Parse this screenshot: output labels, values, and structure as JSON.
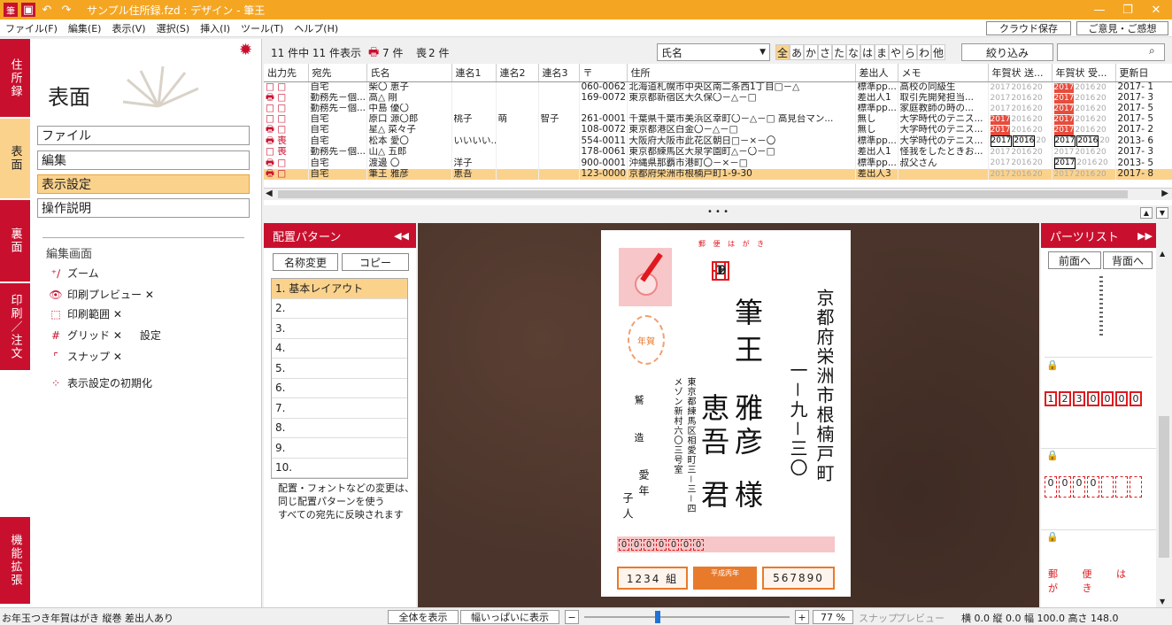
{
  "titlebar": {
    "title": "サンプル住所録.fzd : デザイン - 筆王",
    "minimize": "—",
    "restore": "❐",
    "close": "✕"
  },
  "menu": [
    "ファイル(F)",
    "編集(E)",
    "表示(V)",
    "選択(S)",
    "挿入(I)",
    "ツール(T)",
    "ヘルプ(H)"
  ],
  "top_buttons": {
    "cloud": "クラウド保存",
    "feedback": "ご意見・ご感想"
  },
  "vtabs": [
    "住所録",
    "表面",
    "裏面",
    "印刷／注文",
    "機能拡張"
  ],
  "left": {
    "title": "表面",
    "nav": [
      "ファイル",
      "編集",
      "表示設定",
      "操作説明"
    ],
    "section": "編集画面",
    "tools": [
      {
        "label": "ズーム"
      },
      {
        "label": "印刷プレビュー ✕"
      },
      {
        "label": "印刷範囲 ✕"
      },
      {
        "label": "グリッド ✕",
        "extra": "設定"
      },
      {
        "label": "スナップ ✕"
      },
      {
        "label": "表示設定の初期化"
      }
    ]
  },
  "list": {
    "count_text": "11 件中 11 件表示",
    "printer_count": "7 件",
    "mourn_label": "喪",
    "mourn_count": "2 件",
    "sort": "氏名",
    "kana": [
      "全",
      "あ",
      "か",
      "さ",
      "た",
      "な",
      "は",
      "ま",
      "や",
      "ら",
      "わ",
      "他"
    ],
    "filter_btn": "絞り込み",
    "search_placeholder": "",
    "headers": [
      "出力先",
      "宛先",
      "氏名",
      "連名1",
      "連名2",
      "連名3",
      "〒",
      "住所",
      "差出人",
      "メモ",
      "年賀状 送...",
      "年賀状 受...",
      "更新日"
    ],
    "rows": [
      [
        "□ □",
        "自宅",
        "柴〇 恵子",
        "",
        "",
        "",
        "060-0062",
        "北海道札幌市中央区南二条西1丁目□－△",
        "標準pp...",
        "高校の同級生"
      ],
      [
        "🖶 □",
        "勤務先－個...",
        "高△ 剛",
        "",
        "",
        "",
        "169-0072",
        "東京都新宿区大久保〇－△－□",
        "差出人1",
        "取引先開発担当..."
      ],
      [
        "□ □",
        "勤務先－個...",
        "中島 優〇",
        "",
        "",
        "",
        "",
        "",
        "標準pp...",
        "家庭教師の時の..."
      ],
      [
        "□ □",
        "自宅",
        "原口 源〇郎",
        "桃子",
        "萌",
        "智子",
        "261-0001",
        "千葉県千葉市美浜区幸町〇－△－□ 高見台マン...",
        "無し",
        "大学時代のテニス..."
      ],
      [
        "🖶 □",
        "自宅",
        "星△ 菜々子",
        "",
        "",
        "",
        "108-0072",
        "東京都港区白金〇－△－□",
        "無し",
        "大学時代のテニス..."
      ],
      [
        "🖶 喪",
        "自宅",
        "松本 愛〇",
        "いいいい...",
        "",
        "",
        "554-0011",
        "大阪府大阪市此花区朝日□－×－〇",
        "標準pp...",
        "大学時代のテニス..."
      ],
      [
        "□ 喪",
        "勤務先－個...",
        "山△ 五郎",
        "",
        "",
        "",
        "178-0061",
        "東京都練馬区大泉学園町△－〇－□",
        "差出人1",
        "怪我をしたときお..."
      ],
      [
        "🖶 □",
        "自宅",
        "渡邊 〇",
        "洋子",
        "",
        "",
        "900-0001",
        "沖縄県那覇市港町〇－×－□",
        "標準pp...",
        "叔父さん"
      ],
      [
        "🖶 □",
        "自宅",
        "筆王 雅彦",
        "恵吾",
        "",
        "",
        "123-0000",
        "京都府栄洲市根楠戸町1-9-30",
        "差出人3",
        ""
      ]
    ],
    "sent_years": [
      [
        "2017",
        "2016",
        "20"
      ],
      [
        "2017",
        "2016",
        "20"
      ],
      [
        "2017",
        "2016",
        "20"
      ],
      [
        "2017",
        "2016",
        "20"
      ],
      [
        "2017",
        "2016",
        "20"
      ],
      [
        "2017",
        "2016",
        "20"
      ],
      [
        "2017",
        "2016",
        "20"
      ],
      [
        "2017",
        "2016",
        "20"
      ],
      [
        "2017",
        "2016",
        "20"
      ]
    ],
    "recv_years": [
      [
        "2017",
        "2016",
        "20"
      ],
      [
        "2017",
        "2016",
        "20"
      ],
      [
        "2017",
        "2016",
        "20"
      ],
      [
        "2017",
        "2016",
        "20"
      ],
      [
        "2017",
        "2016",
        "20"
      ],
      [
        "2017",
        "2016",
        "20"
      ],
      [
        "2017",
        "2016",
        "20"
      ],
      [
        "2017",
        "2016",
        "20"
      ],
      [
        "2017",
        "2016",
        "20"
      ]
    ],
    "updated": [
      "2017- 1",
      "2017- 3",
      "2017- 5",
      "2017- 5",
      "2017- 2",
      "2013- 6",
      "2017- 3",
      "2013- 5",
      "2017- 8"
    ]
  },
  "splitter": "• • •",
  "pattern": {
    "title": "配置パターン",
    "rename": "名称変更",
    "copy": "コピー",
    "items": [
      "1. 基本レイアウト",
      "2.",
      "3.",
      "4.",
      "5.",
      "6.",
      "7.",
      "8.",
      "9.",
      "10."
    ],
    "note": [
      "配置・フォントなどの変更は、",
      "同じ配置パターンを使う",
      "すべての宛先に反映されます"
    ]
  },
  "card": {
    "header": "郵 便 は が き",
    "zip": [
      "1",
      "2",
      "3",
      "0",
      "0",
      "0",
      "0"
    ],
    "address1": "京都府栄洲市根楠戸町",
    "address2": "一－九－三〇",
    "family": "筆王",
    "given1": "雅彦",
    "honor": "様",
    "given2": "恵吾",
    "honor2": "君",
    "sender_address": "東京都練馬区相愛町三－三－四 メゾン新村六〇三号室",
    "sender_name1": "愛年",
    "sender_name2": "子人",
    "sender_label": "鷲 造",
    "sender_zip": [
      "0",
      "0",
      "0",
      "0",
      "0",
      "0",
      "0"
    ],
    "lottery_left": "1234 組",
    "lottery_center": "平成丙年",
    "lottery_right": "567890",
    "stamp": "年賀"
  },
  "parts": {
    "title": "パーツリスト",
    "front": "前面へ",
    "back": "背面へ",
    "zip1": [
      "1",
      "2",
      "3",
      "0",
      "0",
      "0",
      "0"
    ],
    "zip2": [
      "0",
      "0",
      "0",
      "0",
      "",
      "",
      ""
    ],
    "header": "郵 便 は が き"
  },
  "status": {
    "left": "お年玉つき年賀はがき 縦巻 差出人あり",
    "fit_all": "全体を表示",
    "fit_width": "幅いっぱいに表示",
    "minus": "−",
    "plus": "+",
    "zoom": "77 %",
    "snap": "スナップ",
    "preview": "プレビュー",
    "dims": "横 0.0 縦 0.0 幅 100.0 高さ 148.0"
  },
  "colors": {
    "accent": "#c8102e",
    "title_bar": "#f4a623",
    "selection": "#fbd28c",
    "canvas": "#4a342b"
  }
}
